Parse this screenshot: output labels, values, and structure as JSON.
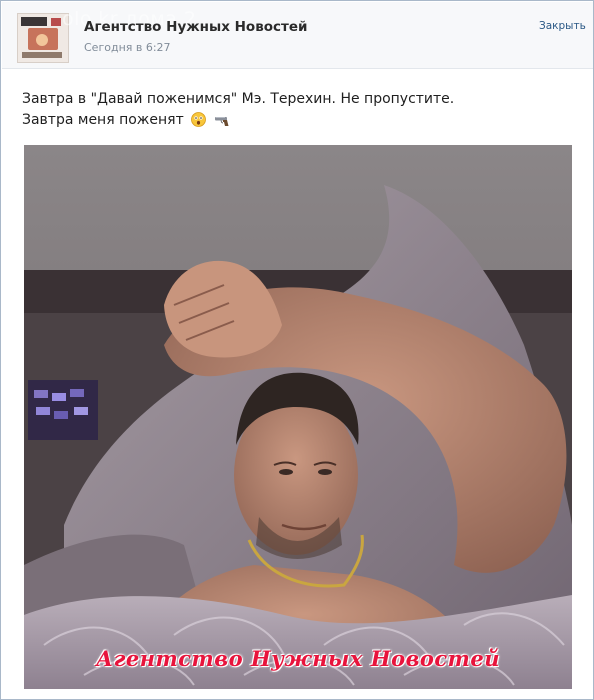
{
  "header": {
    "page_title": "Агентство Нужных Новостей",
    "timestamp": "Сегодня в 6:27",
    "close_label": "Закрыть",
    "watermark": "olo.kr           дома 2"
  },
  "post": {
    "text_line_1": "Завтра в \"Давай поженимся\" Мэ. Терехин. Не пропустите.",
    "text_line_2": "Завтра меня поженят",
    "emoji_icons": [
      "astonished-face-icon",
      "pistol-icon"
    ]
  },
  "photo": {
    "caption": "Агентство Нужных Новостей"
  },
  "colors": {
    "border": "#a9b8c9",
    "header_bg": "#f7f8fa",
    "link": "#2a5885",
    "caption": "#e8143c"
  }
}
